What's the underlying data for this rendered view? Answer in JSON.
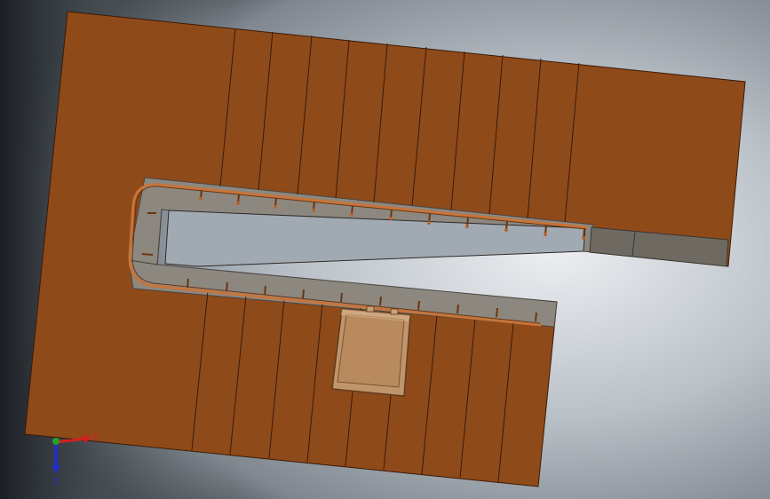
{
  "scene": {
    "background_colors": [
      "#1e2226",
      "#8f979f",
      "#e6e9ec",
      "#9aa3ad"
    ],
    "model_color": "#8f4a1a",
    "model_edge_color": "#3a1a06",
    "slab_color": "#8f8a80",
    "rail_color": "#b9652c",
    "box_color": "#c0956b"
  },
  "triad": {
    "x_label": "X",
    "y_label": "Y",
    "z_label": "Z",
    "x_color": "#d42020",
    "y_color": "#2aa02a",
    "z_color": "#2030c0"
  }
}
